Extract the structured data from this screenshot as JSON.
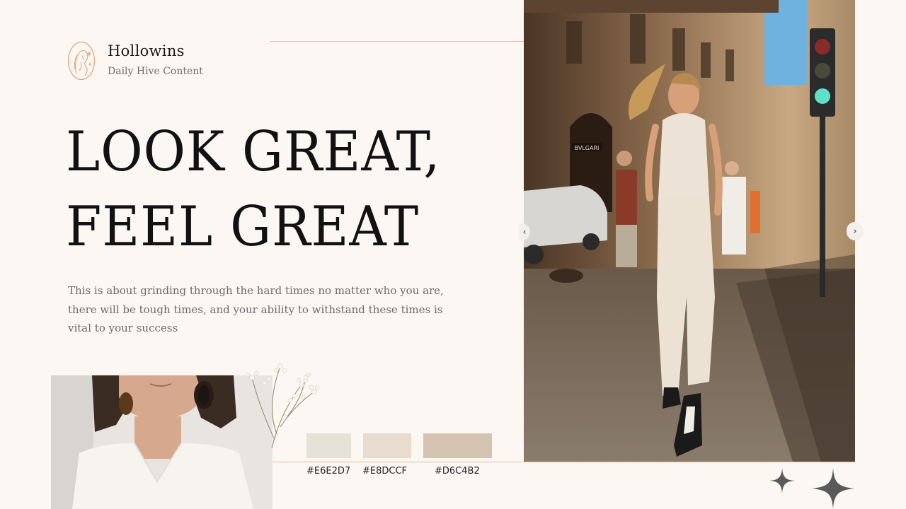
{
  "brand": {
    "name": "Hollowins",
    "tagline": "Daily Hive Content"
  },
  "headline": {
    "line1": "LOOK GREAT,",
    "line2": "FEEL GREAT"
  },
  "body": "This is about grinding through the hard times no matter who you are, there will be tough times, and your ability to withstand these times is vital to your success",
  "hero_photo": {
    "sign_text": "BVLGARI"
  },
  "carousel": {
    "prev_icon": "‹",
    "next_icon": "›"
  },
  "palette": [
    {
      "hex": "#E6E2D7",
      "label": "#E6E2D7"
    },
    {
      "hex": "#E8DCCF",
      "label": "#E8DCCF"
    },
    {
      "hex": "#D6C4B2",
      "label": "#D6C4B2"
    }
  ],
  "colors": {
    "background": "#fcf7f2",
    "accent_line": "#e6bc9c",
    "logo_stroke": "#e0a47a",
    "sparkle": "#5a5a5a"
  }
}
